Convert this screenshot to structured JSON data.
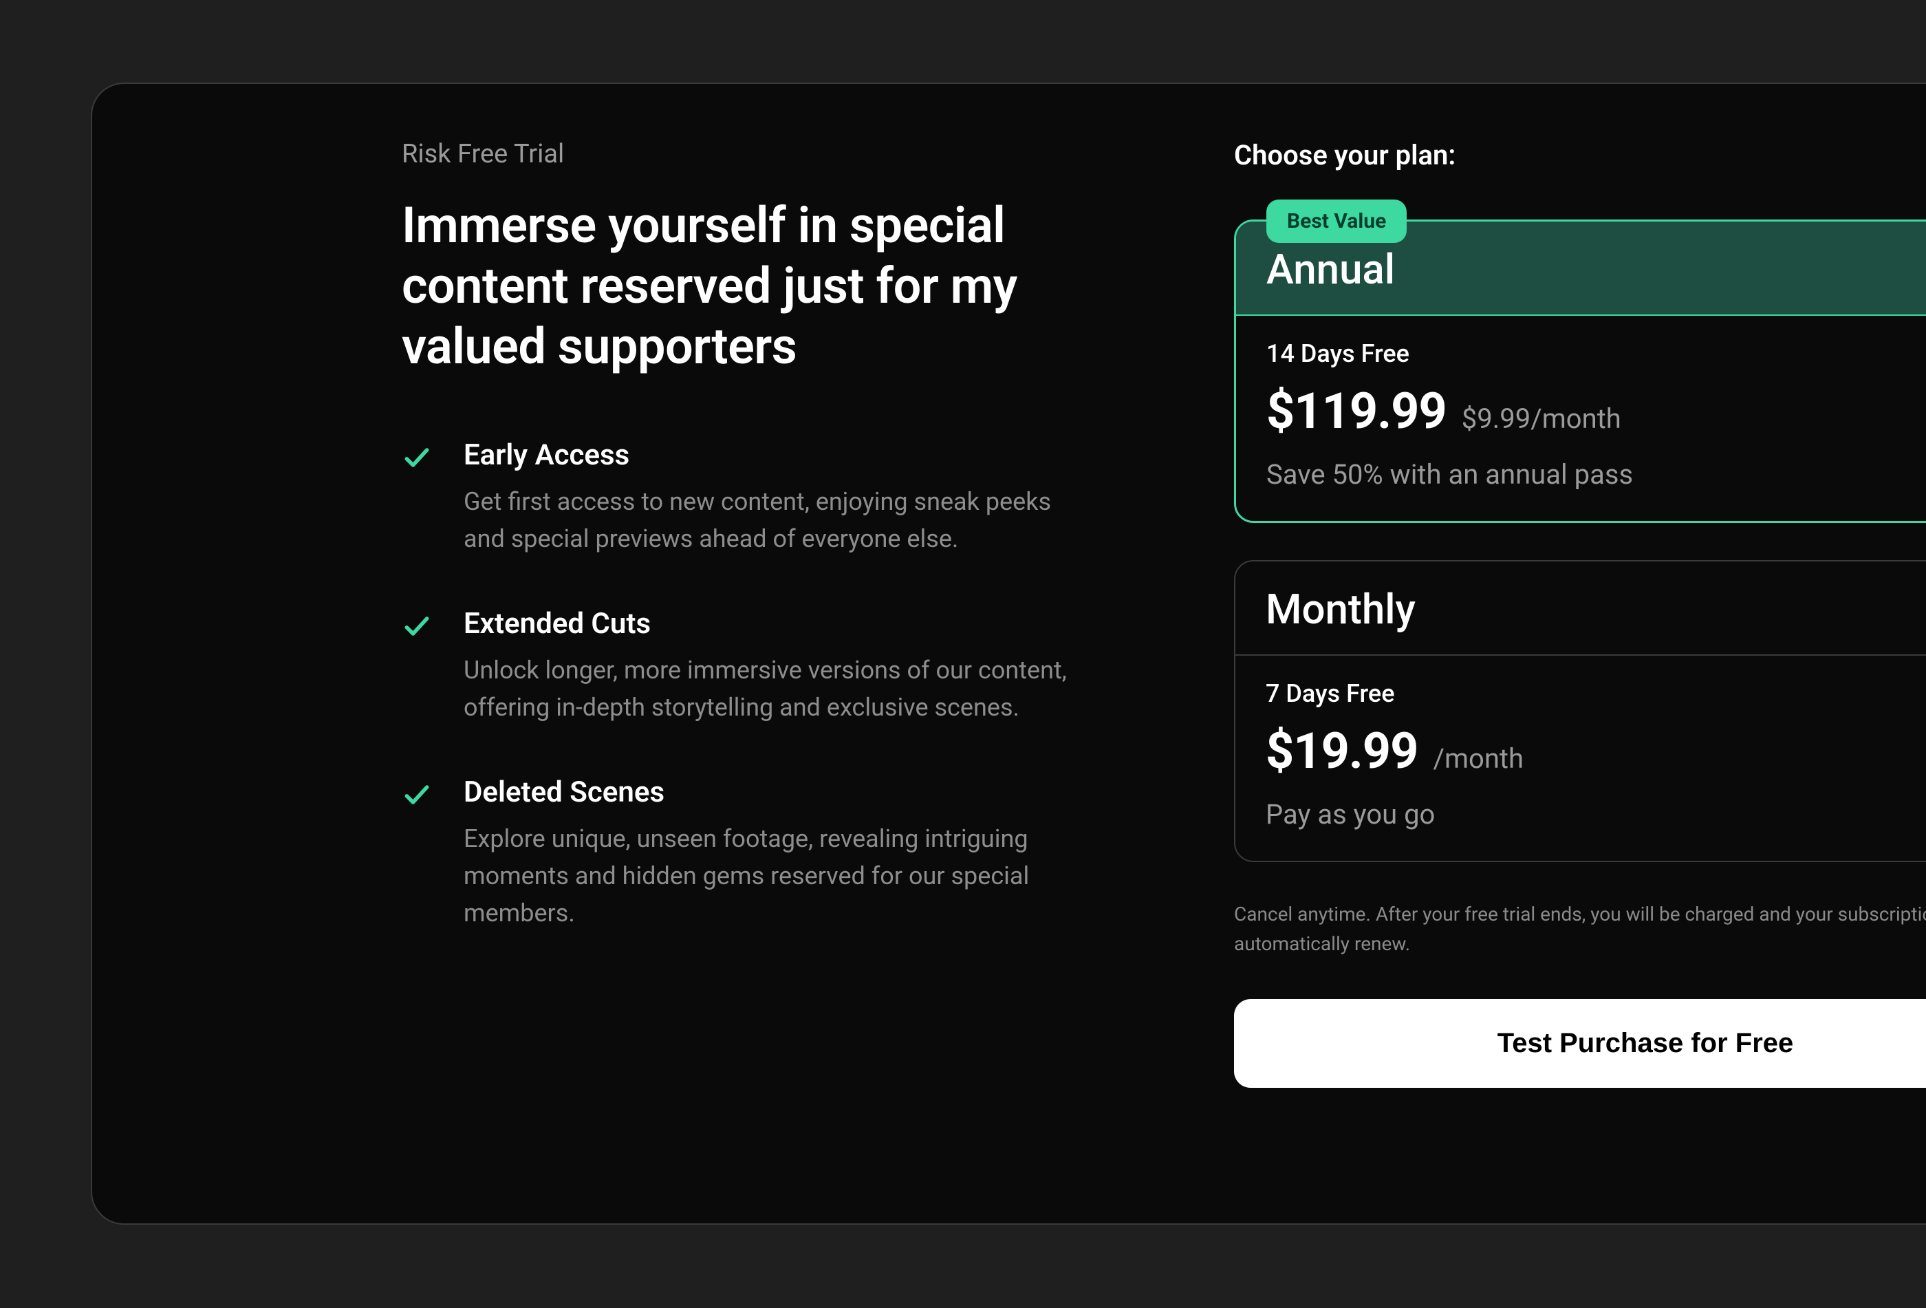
{
  "left": {
    "kicker": "Risk Free Trial",
    "headline": "Immerse yourself in special content reserved just for my valued supporters",
    "features": [
      {
        "title": "Early Access",
        "desc": "Get first access to new content, enjoying sneak peeks and special previews ahead of everyone else."
      },
      {
        "title": "Extended Cuts",
        "desc": "Unlock longer, more immersive versions of our content, offering in-depth storytelling and exclusive scenes."
      },
      {
        "title": "Deleted Scenes",
        "desc": "Explore unique, unseen footage, revealing intriguing moments and hidden gems reserved for our special members."
      }
    ]
  },
  "right": {
    "choose_label": "Choose your plan:",
    "plans": [
      {
        "badge": "Best Value",
        "name": "Annual",
        "trial": "14 Days Free",
        "price": "$119.99",
        "per": "$9.99/month",
        "note": "Save 50% with an annual pass",
        "selected": true
      },
      {
        "name": "Monthly",
        "trial": "7 Days Free",
        "price": "$19.99",
        "per": "/month",
        "note": "Pay as you go",
        "selected": false
      }
    ],
    "disclaimer": "Cancel anytime. After your free trial ends, you will be charged and your subscription will automatically renew.",
    "cta_label": "Test Purchase for Free"
  },
  "colors": {
    "accent": "#3dd9a0",
    "bg": "#1f1f1f",
    "card": "#0a0a0a"
  }
}
